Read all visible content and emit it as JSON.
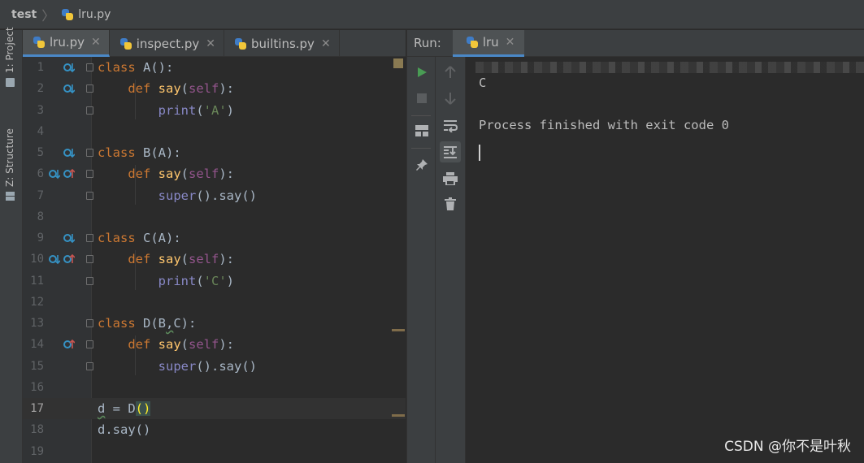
{
  "breadcrumb": {
    "project": "test",
    "file": "lru.py"
  },
  "tool_strip": {
    "project_label": "1: Project",
    "structure_label": "Z: Structure"
  },
  "editor": {
    "tabs": [
      {
        "label": "lru.py",
        "active": true
      },
      {
        "label": "inspect.py",
        "active": false
      },
      {
        "label": "builtins.py",
        "active": false
      }
    ],
    "current_line": 17,
    "lines": [
      {
        "n": "1",
        "gutter": [
          "overridden"
        ],
        "code": "class A():"
      },
      {
        "n": "2",
        "gutter": [
          "overridden"
        ],
        "code": "    def say(self):"
      },
      {
        "n": "3",
        "gutter": [],
        "code": "        print('A')"
      },
      {
        "n": "4",
        "gutter": [],
        "code": ""
      },
      {
        "n": "5",
        "gutter": [
          "overridden"
        ],
        "code": "class B(A):"
      },
      {
        "n": "6",
        "gutter": [
          "overridden",
          "overrides"
        ],
        "code": "    def say(self):"
      },
      {
        "n": "7",
        "gutter": [],
        "code": "        super().say()"
      },
      {
        "n": "8",
        "gutter": [],
        "code": ""
      },
      {
        "n": "9",
        "gutter": [
          "overridden"
        ],
        "code": "class C(A):"
      },
      {
        "n": "10",
        "gutter": [
          "overridden",
          "overrides"
        ],
        "code": "    def say(self):"
      },
      {
        "n": "11",
        "gutter": [],
        "code": "        print('C')"
      },
      {
        "n": "12",
        "gutter": [],
        "code": ""
      },
      {
        "n": "13",
        "gutter": [],
        "code": "class D(B,C):"
      },
      {
        "n": "14",
        "gutter": [
          "overrides"
        ],
        "code": "    def say(self):"
      },
      {
        "n": "15",
        "gutter": [],
        "code": "        super().say()"
      },
      {
        "n": "16",
        "gutter": [],
        "code": ""
      },
      {
        "n": "17",
        "gutter": [],
        "code": "d = D()"
      },
      {
        "n": "18",
        "gutter": [],
        "code": "d.say()"
      },
      {
        "n": "19",
        "gutter": [],
        "code": ""
      }
    ]
  },
  "run": {
    "label": "Run:",
    "tab_label": "lru",
    "output_line": "C",
    "exit_message": "Process finished with exit code 0"
  },
  "icons": {
    "toolbar_1": [
      "run-icon",
      "stop-icon",
      "layout-icon",
      "pin-icon"
    ],
    "toolbar_2": [
      "arrow-up-icon",
      "arrow-down-icon",
      "soft-wrap-icon",
      "scroll-to-end-icon",
      "print-icon",
      "trash-icon"
    ]
  },
  "colors": {
    "keyword": "#cc7832",
    "function": "#ffc66d",
    "self": "#94558d",
    "string": "#6a8759",
    "builtin": "#8888c6",
    "run_green": "#499c54",
    "tab_underline": "#4a88c7"
  },
  "watermark": "CSDN @你不是叶秋"
}
